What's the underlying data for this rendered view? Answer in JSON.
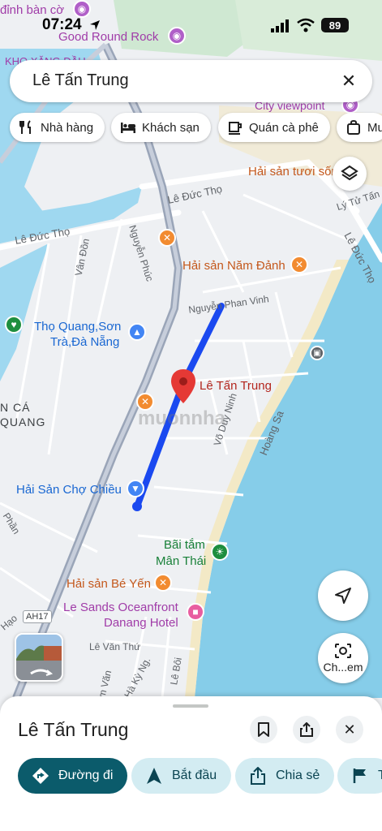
{
  "status_bar": {
    "time": "07:24",
    "battery": "89"
  },
  "search": {
    "query": "Lê Tấn Trung"
  },
  "chips": [
    {
      "label": "Nhà hàng"
    },
    {
      "label": "Khách sạn"
    },
    {
      "label": "Quán cà phê"
    },
    {
      "label": "Mu"
    }
  ],
  "map": {
    "pois": {
      "dinh_ban_co": "đỉnh bàn cờ",
      "good_round_rock": "Good Round Rock",
      "kho_xang_dau": "KHO XĂNG DẦU",
      "city_viewpoint": "City viewpoint",
      "hai_san_tuoi_song": "Hải sản tươi sống Rô",
      "hai_san_nam_danh": "Hải sản Năm Đảnh",
      "tho_quang_son_tra_line1": "Thọ Quang,Sơn",
      "tho_quang_son_tra_line2": "Trà,Đà Nẵng",
      "le_tan_trung_pin": "Lê Tấn Trung",
      "hai_san_cho_chieu": "Hải Sản Chợ Chiều",
      "bai_tam_line1": "Bãi tắm",
      "bai_tam_line2": "Mân Thái",
      "hai_san_be_yen": "Hải sản Bé Yến",
      "le_sands_line1": "Le Sands Oceanfront",
      "le_sands_line2": "Danang Hotel"
    },
    "areas": {
      "an_ca": "N CÁ",
      "quang": "QUANG"
    },
    "roads": {
      "le_duc_tho_1": "Lê Đức Thọ",
      "le_duc_tho_2": "Lê Đức Thọ",
      "le_duc_tho_3": "Lê Đức Thọ",
      "ly_tu_tan": "Lý Tử Tấn",
      "nguyen_phuc": "Nguyễn Phúc",
      "van_don": "Vân Đồn",
      "nguyen_phan_vinh": "Nguyễn Phan Vinh",
      "vo_duy_ninh": "Võ Duy Ninh",
      "hoang_sa": "Hoàng Sa",
      "phan": "Phần",
      "hao": "Hạo",
      "le_van_thu": "Lê Văn Thứ",
      "ha_ky_ng": "Hà Kỳ Ng.",
      "le_boi": "Lê Bôi",
      "m_van": "m Văn",
      "ah17": "AH17"
    },
    "watermark": "muonnha"
  },
  "camera_button": {
    "label": "Ch...em"
  },
  "place": {
    "title": "Lê Tấn Trung"
  },
  "actions": [
    {
      "label": "Đường đi"
    },
    {
      "label": "Bắt đầu"
    },
    {
      "label": "Chia sẻ"
    },
    {
      "label": "T"
    }
  ],
  "colors": {
    "water": "#9fd8f0",
    "land": "#eef0f3",
    "route": "#1a49f0",
    "pin": "#e53935",
    "primary_action": "#0b5b6b",
    "secondary_action": "#d3ecf2"
  }
}
